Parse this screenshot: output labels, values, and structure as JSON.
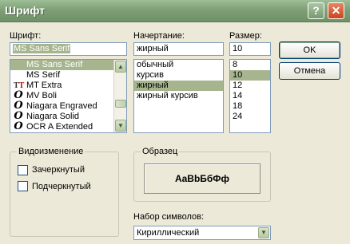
{
  "window": {
    "title": "Шрифт"
  },
  "labels": {
    "font": "Шрифт:",
    "style": "Начертание:",
    "size": "Размер:"
  },
  "font": {
    "value": "MS Sans Serif",
    "items": [
      {
        "label": "MS Sans Serif",
        "icon": "none"
      },
      {
        "label": "MS Serif",
        "icon": "none"
      },
      {
        "label": "MT Extra",
        "icon": "truetype-icon"
      },
      {
        "label": "MV Boli",
        "icon": "opentype-icon"
      },
      {
        "label": "Niagara Engraved",
        "icon": "opentype-icon"
      },
      {
        "label": "Niagara Solid",
        "icon": "opentype-icon"
      },
      {
        "label": "OCR A Extended",
        "icon": "opentype-icon"
      }
    ],
    "selected_index": 0
  },
  "style": {
    "value": "жирный",
    "items": [
      "обычный",
      "курсив",
      "жирный",
      "жирный курсив"
    ],
    "selected_index": 2
  },
  "size": {
    "value": "10",
    "items": [
      "8",
      "10",
      "12",
      "14",
      "18",
      "24"
    ],
    "selected_index": 1
  },
  "buttons": {
    "ok": "OK",
    "cancel": "Отмена"
  },
  "effects": {
    "title": "Видоизменение",
    "strikeout": "Зачеркнутый",
    "underline": "Подчеркнутый"
  },
  "sample": {
    "title": "Образец",
    "text": "AaBbБбФф"
  },
  "charset": {
    "label": "Набор символов:",
    "value": "Кириллический"
  },
  "colors": {
    "titlebar": "#7FA077",
    "selection": "#A7B58F",
    "close": "#C8461E"
  }
}
